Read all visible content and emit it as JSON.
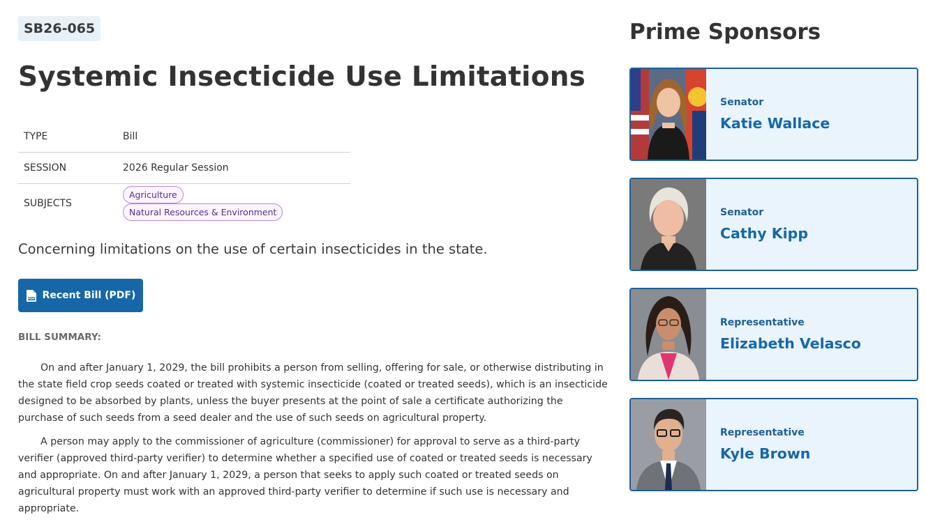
{
  "bill": {
    "id": "SB26-065",
    "title": "Systemic Insecticide Use Limitations",
    "meta": [
      {
        "key": "TYPE",
        "value": "Bill"
      },
      {
        "key": "SESSION",
        "value": "2026 Regular Session"
      },
      {
        "key": "SUBJECTS",
        "tags": [
          "Agriculture",
          "Natural Resources & Environment"
        ]
      }
    ],
    "description": "Concerning limitations on the use of certain insecticides in the state.",
    "pdf_button_label": "Recent Bill (PDF)",
    "summary_heading": "BILL SUMMARY:",
    "summary_paragraphs": [
      "On and after January 1, 2029, the bill prohibits a person from selling, offering for sale, or otherwise distributing in the state field crop seeds coated or treated with systemic insecticide (coated or treated seeds), which is an insecticide designed to be absorbed by plants, unless the buyer presents at the point of sale a certificate authorizing the purchase of such seeds from a seed dealer and the use of such seeds on agricultural property.",
      "A person may apply to the commissioner of agriculture (commissioner) for approval to serve as a third-party verifier (approved third-party verifier) to determine whether a specified use of coated or treated seeds is necessary and appropriate. On and after January 1, 2029, a person that seeks to apply such coated or treated seeds on agricultural property must work with an approved third-party verifier to determine if such use is necessary and appropriate."
    ]
  },
  "sponsors": {
    "heading": "Prime Sponsors",
    "items": [
      {
        "role": "Senator",
        "name": "Katie Wallace"
      },
      {
        "role": "Senator",
        "name": "Cathy Kipp"
      },
      {
        "role": "Representative",
        "name": "Elizabeth Velasco"
      },
      {
        "role": "Representative",
        "name": "Kyle Brown"
      }
    ]
  },
  "colors": {
    "accent": "#1767a8",
    "card_border": "#1f5f94",
    "card_bg": "#eaf4fd",
    "tag_border": "#b58ad8",
    "tag_text": "#5b2d86"
  }
}
